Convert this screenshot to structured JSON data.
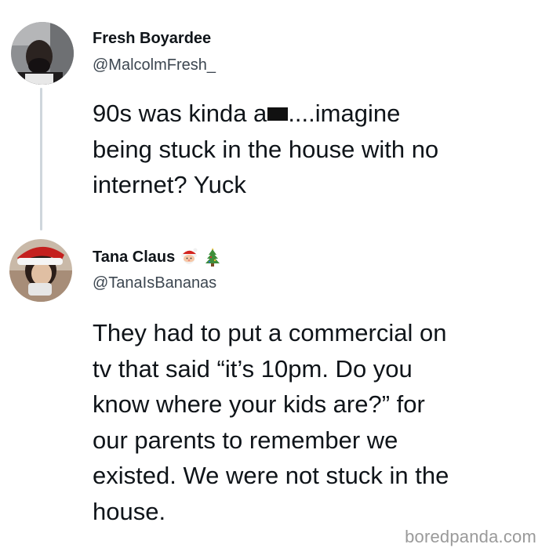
{
  "tweet1": {
    "display_name": "Fresh Boyardee",
    "handle": "@MalcolmFresh_",
    "line1_prefix": "90s was kinda a",
    "line1_suffix": "....imagine",
    "line2": "being stuck in the house with no",
    "line3": "internet? Yuck",
    "avatar_icon": "profile-photo-man-icon"
  },
  "tweet2": {
    "display_name": "Tana Claus",
    "handle": "@TanaIsBananas",
    "emojis": [
      "santa-face-icon",
      "christmas-tree-icon"
    ],
    "lines": [
      "They had to put a commercial on",
      "tv that said “it’s 10pm. Do you",
      "know where your kids are?” for",
      "our parents to remember we",
      "existed. We were not stuck in the",
      "house."
    ],
    "avatar_icon": "profile-photo-woman-santa-hat-icon"
  },
  "watermark": "boredpanda.com",
  "colors": {
    "text": "#0f1419",
    "handle": "#3c4650",
    "thread_line": "#cfd6dc",
    "watermark": "#9a9a9a"
  }
}
